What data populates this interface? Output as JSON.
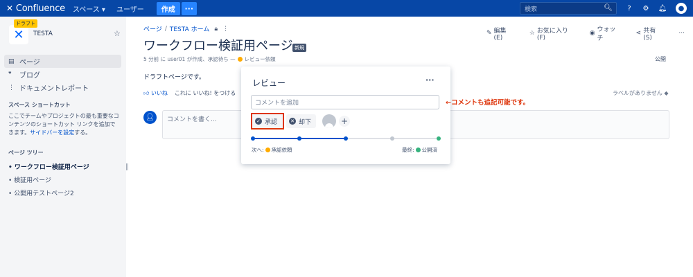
{
  "topbar": {
    "logo": "Confluence",
    "nav_spaces": "スペース ▾",
    "nav_users": "ユーザー",
    "create_label": "作成",
    "more_label": "···",
    "search_placeholder": "検索",
    "bg_color": "#0747a6",
    "accent_color": "#2684ff"
  },
  "sidebar": {
    "draft_badge": "ドラフト",
    "space_name": "TESTA",
    "items": [
      {
        "label": "ページ",
        "icon": "page-icon"
      },
      {
        "label": "ブログ",
        "icon": "quote-icon"
      },
      {
        "label": "ドキュメントレポート",
        "icon": "tree-icon"
      }
    ],
    "shortcuts_heading": "スペース ショートカット",
    "shortcuts_text_1": "ここでチームやプロジェクトの最も重要なコンテンツのショートカット リンクを追加できます。",
    "shortcuts_link": "サイドバーを設定",
    "shortcuts_text_2": "する。",
    "tree_heading": "ページ ツリー",
    "tree_items": [
      "ワークフロー検証用ページ",
      "検証用ページ",
      "公開用テストページ2"
    ]
  },
  "breadcrumb": {
    "pages": "ページ",
    "home": "TESTA ホーム"
  },
  "actions": {
    "edit": "編集(E)",
    "favorite": "お気に入り(F)",
    "watch": "ウォッチ",
    "share": "共有(S)",
    "more": "···"
  },
  "page": {
    "title": "ワークフロー検証用ページ",
    "new_badge": "新規",
    "byline_prefix": "5 分前 に user01 が作成、承認待ち —",
    "byline_status": "レビュー依頼",
    "publish_label": "公開",
    "draft_text": "ドラフトページです。",
    "like_label": "いいね",
    "like_prompt": "これに いいね! をつける",
    "labels_none": "ラベルがありません",
    "comment_placeholder": "コメントを書く..."
  },
  "review": {
    "title": "レビュー",
    "more": "···",
    "comment_placeholder": "コメントを追加",
    "approve_label": "承認",
    "reject_label": "却下",
    "add_label": "+",
    "progress": 0.5,
    "next_label": "次へ:",
    "next_value": "承認依頼",
    "last_label": "最終:",
    "last_value": "公開済",
    "pending_color": "#ffab00",
    "done_color": "#36b37e",
    "track_color": "#0052cc"
  },
  "annotation": "←コメントも追記可能です。"
}
